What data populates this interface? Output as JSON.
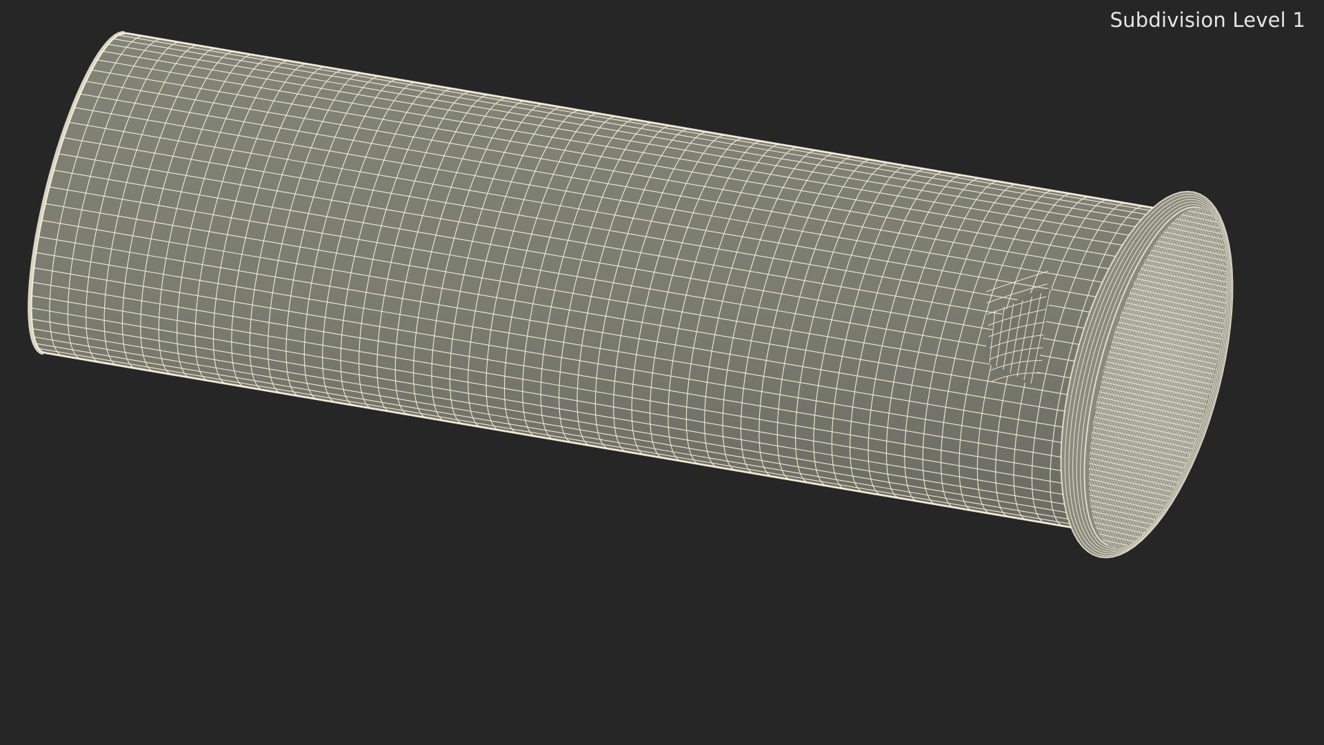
{
  "viewport": {
    "label": "Subdivision Level 1"
  },
  "colors": {
    "background": "#262626",
    "surface": "#7b7c70",
    "wire": "#f6f4e0",
    "shadow": "#5f6058"
  }
}
